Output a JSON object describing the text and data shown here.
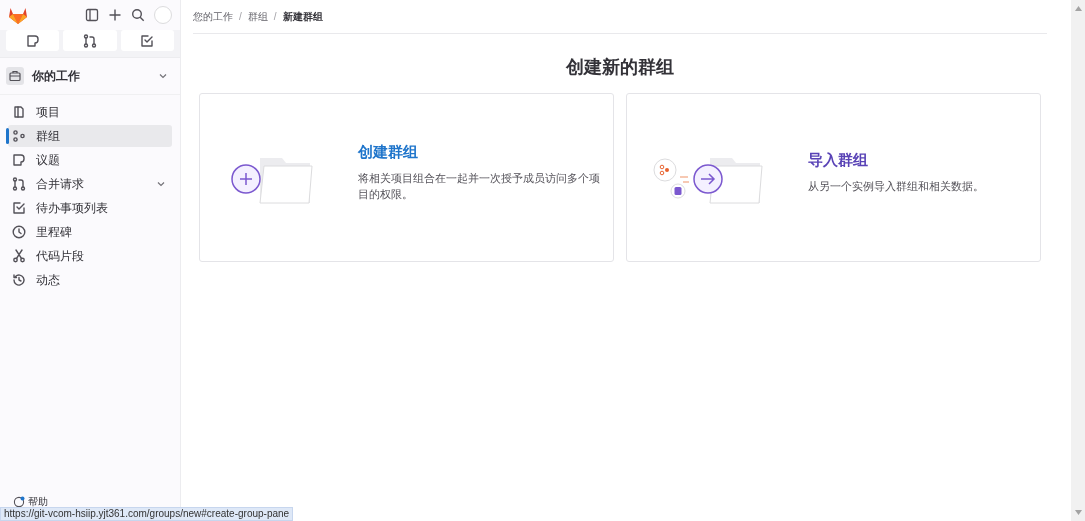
{
  "sidebar": {
    "quick_buttons": [
      {
        "kind": "issues"
      },
      {
        "kind": "merge"
      },
      {
        "kind": "todo"
      }
    ],
    "section": {
      "title": "你的工作",
      "expanded": true
    },
    "items": [
      {
        "label": "项目",
        "kind": "project",
        "selected": false,
        "has_children": false
      },
      {
        "label": "群组",
        "kind": "group",
        "selected": true,
        "has_children": false
      },
      {
        "label": "议题",
        "kind": "issues",
        "selected": false,
        "has_children": false
      },
      {
        "label": "合并请求",
        "kind": "merge",
        "selected": false,
        "has_children": true
      },
      {
        "label": "待办事项列表",
        "kind": "todo",
        "selected": false,
        "has_children": false
      },
      {
        "label": "里程碑",
        "kind": "clock",
        "selected": false,
        "has_children": false
      },
      {
        "label": "代码片段",
        "kind": "scissors",
        "selected": false,
        "has_children": false
      },
      {
        "label": "动态",
        "kind": "history",
        "selected": false,
        "has_children": false
      }
    ],
    "help": "帮助"
  },
  "breadcrumb": [
    {
      "label": "您的工作",
      "current": false
    },
    {
      "separator": "/",
      "label": "群组",
      "current": false
    },
    {
      "separator": "/",
      "label": "新建群组",
      "current": true
    }
  ],
  "page_title": "创建新的群组",
  "cards": [
    {
      "kind": "create",
      "title": "创建群组",
      "description": "将相关项目组合在一起并一次授予成员访问多个项目的权限。"
    },
    {
      "kind": "import",
      "title": "导入群组",
      "description": "从另一个实例导入群组和相关数据。"
    }
  ],
  "status_bar": "https://git-vcom-hsiip.yjt361.com/groups/new#create-group-pane"
}
